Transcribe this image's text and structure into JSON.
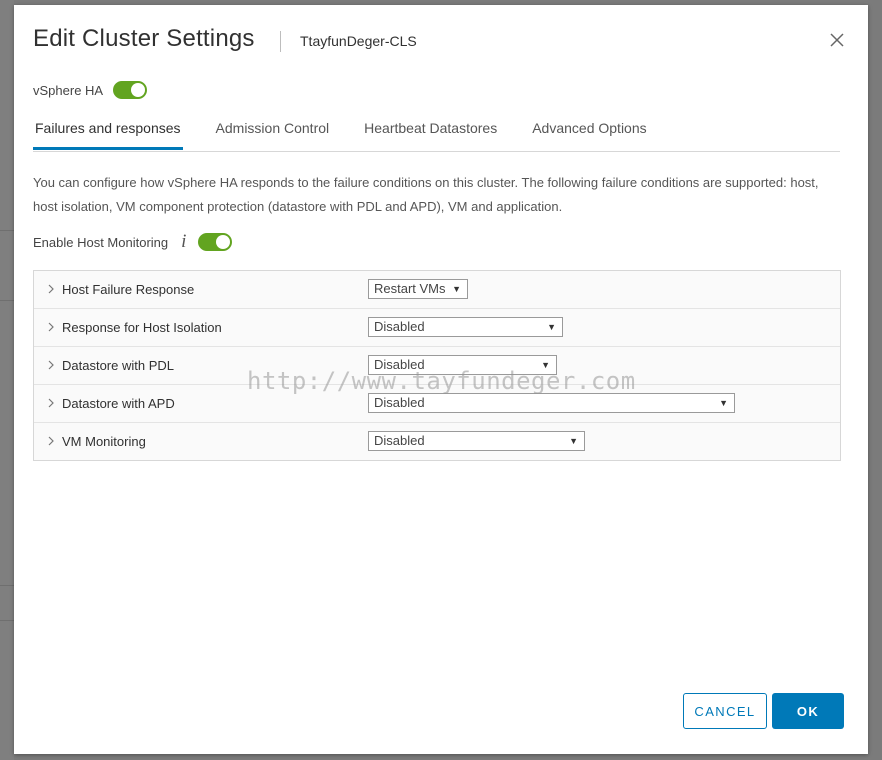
{
  "dialog": {
    "title": "Edit Cluster Settings",
    "subtitle": "TtayfunDeger-CLS"
  },
  "ha": {
    "label": "vSphere HA",
    "enabled": true
  },
  "tabs": [
    {
      "label": "Failures and responses",
      "active": true
    },
    {
      "label": "Admission Control",
      "active": false
    },
    {
      "label": "Heartbeat Datastores",
      "active": false
    },
    {
      "label": "Advanced Options",
      "active": false
    }
  ],
  "description": "You can configure how vSphere HA responds to the failure conditions on this cluster. The following failure conditions are supported: host, host isolation, VM component protection (datastore with PDL and APD), VM and application.",
  "host_monitoring": {
    "label": "Enable Host Monitoring",
    "info_icon": "i",
    "enabled": true
  },
  "settings": [
    {
      "label": "Host Failure Response",
      "value": "Restart VMs"
    },
    {
      "label": "Response for Host Isolation",
      "value": "Disabled"
    },
    {
      "label": "Datastore with PDL",
      "value": "Disabled"
    },
    {
      "label": "Datastore with APD",
      "value": "Disabled"
    },
    {
      "label": "VM Monitoring",
      "value": "Disabled"
    }
  ],
  "watermark": "http://www.tayfundeger.com",
  "buttons": {
    "cancel": "CANCEL",
    "ok": "OK"
  },
  "colors": {
    "accent": "#0079b8",
    "toggle_on": "#62a420"
  }
}
